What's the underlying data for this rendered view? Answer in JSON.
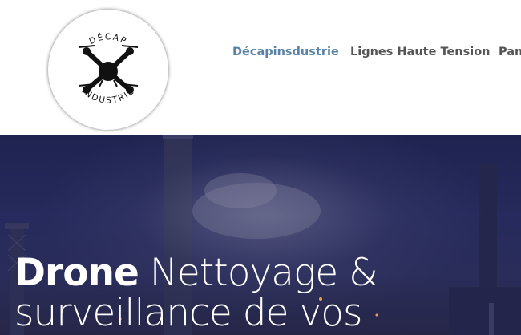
{
  "logo": {
    "top_text": "DÉCAP",
    "bottom_text": "INDUSTRIE"
  },
  "nav": {
    "items": [
      {
        "label": "Décapinsdustrie",
        "active": true
      },
      {
        "label": "Lignes Haute Tension",
        "active": false
      },
      {
        "label": "Pan",
        "active": false
      }
    ]
  },
  "hero": {
    "title_bold": "Drone",
    "title_rest": " Nettoyage &",
    "title_line2": "surveillance de vos"
  },
  "colors": {
    "nav_active": "#5b82a6",
    "nav_default": "#555555",
    "hero_overlay": "#262a5c"
  }
}
